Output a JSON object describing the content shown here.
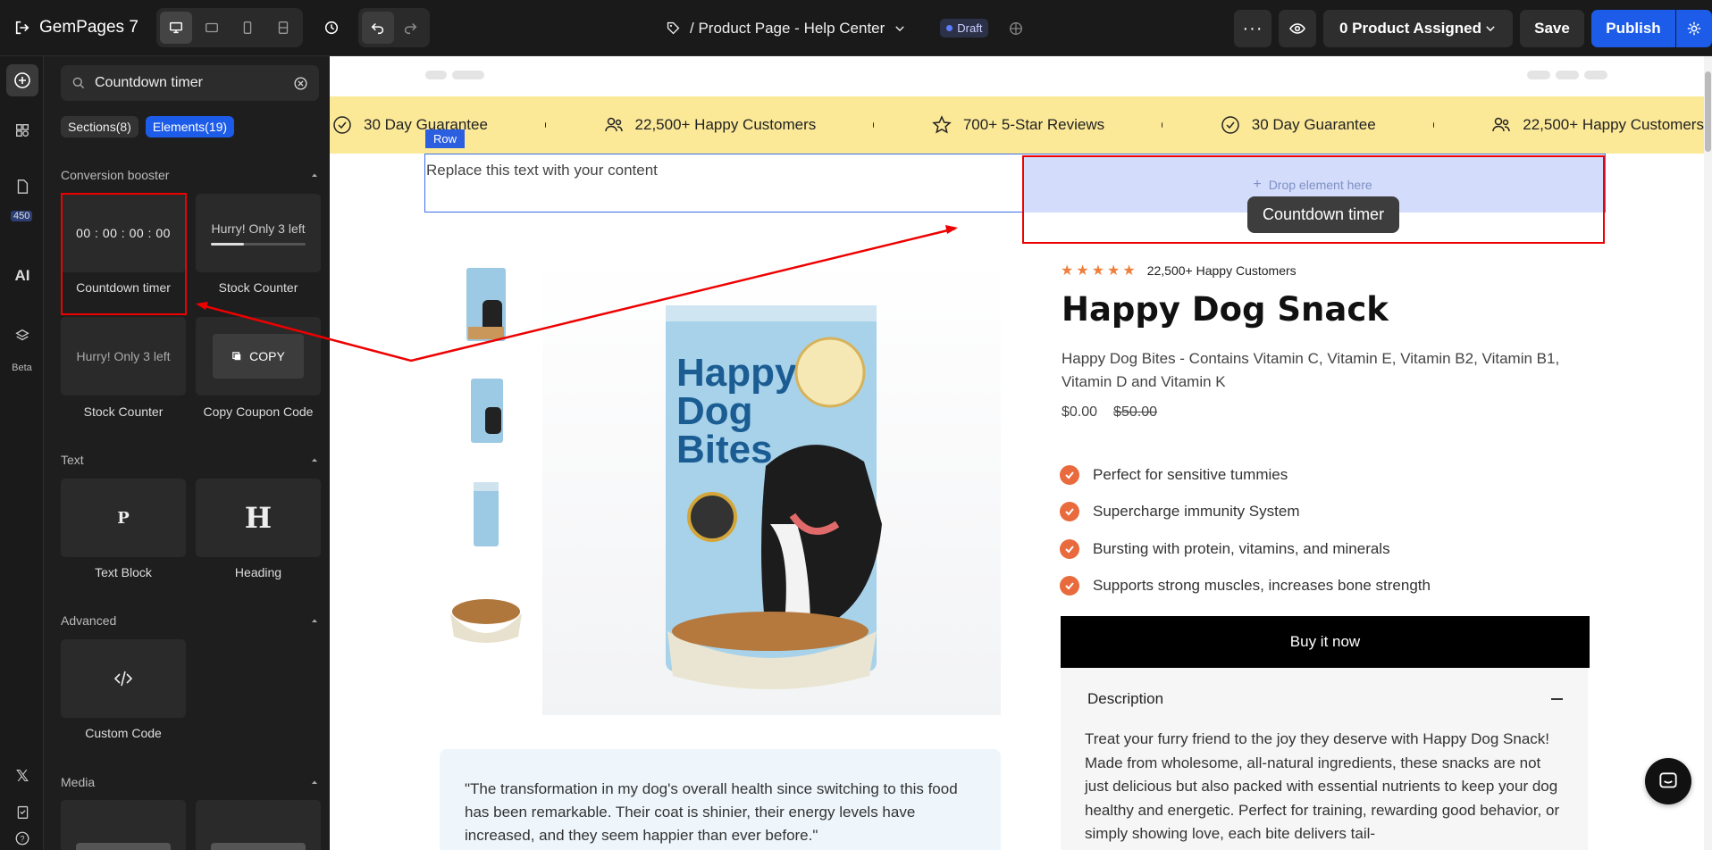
{
  "app": {
    "name": "GemPages 7"
  },
  "toolbar": {
    "page_title": "/ Product Page - Help Center",
    "status": "Draft",
    "product_assigned": "0 Product Assigned",
    "save_label": "Save",
    "publish_label": "Publish"
  },
  "rail": {
    "badge": "450",
    "beta_label": "Beta"
  },
  "panel": {
    "search_value": "Countdown timer",
    "tabs": [
      {
        "label": "Sections(8)",
        "active": false
      },
      {
        "label": "Elements(19)",
        "active": true
      }
    ],
    "sections": {
      "conversion": "Conversion booster",
      "text": "Text",
      "advanced": "Advanced",
      "media": "Media"
    },
    "elements": {
      "countdown": {
        "label": "Countdown timer",
        "preview": "00 : 00 : 00 : 00"
      },
      "stock1": {
        "label": "Stock Counter",
        "preview": "Hurry! Only 3 left",
        "progress": 0.35
      },
      "stock2": {
        "label": "Stock Counter",
        "preview": "Hurry! Only 3 left"
      },
      "coupon": {
        "label": "Copy Coupon Code",
        "preview": "COPY"
      },
      "text_block": {
        "label": "Text Block",
        "preview": "P"
      },
      "heading": {
        "label": "Heading",
        "preview": "H"
      },
      "custom_code": {
        "label": "Custom Code"
      }
    }
  },
  "canvas": {
    "announcement": [
      "30 Day Guarantee",
      "22,500+ Happy Customers",
      "700+ 5-Star Reviews",
      "30 Day Guarantee",
      "22,500+ Happy Customers"
    ],
    "row_label": "Row",
    "row_placeholder": "Replace this text with your content",
    "drop_label": "Drop element here",
    "drag_chip": "Countdown timer",
    "product": {
      "rating_text": "22,500+ Happy Customers",
      "title": "Happy Dog Snack",
      "subtitle": "Happy Dog Bites - Contains Vitamin C, Vitamin E, Vitamin B2, Vitamin B1, Vitamin D and Vitamin K",
      "price": "$0.00",
      "compare_price": "$50.00",
      "features": [
        "Perfect for sensitive tummies",
        "Supercharge immunity System",
        "Bursting with protein, vitamins, and minerals",
        "Supports strong muscles, increases bone strength"
      ],
      "buy_label": "Buy it now",
      "description_heading": "Description",
      "description_body": "Treat your furry friend to the joy they deserve with Happy Dog Snack! Made from wholesome, all-natural ingredients, these snacks are not just delicious but also packed with essential nutrients to keep your dog healthy and energetic. Perfect for training, rewarding good behavior, or simply showing love, each bite delivers tail-",
      "packaging_text": [
        "Happy",
        "Dog",
        "Bites"
      ],
      "testimonial": "\"The transformation in my dog's overall health since switching to this food has been remarkable. Their coat is shinier, their energy levels have increased, and they seem happier than ever before.\""
    }
  },
  "colors": {
    "accent": "#1d5ce8",
    "announce_bg": "#fce998",
    "check": "#e96a3c",
    "drop_zone": "#d3dcfb"
  }
}
